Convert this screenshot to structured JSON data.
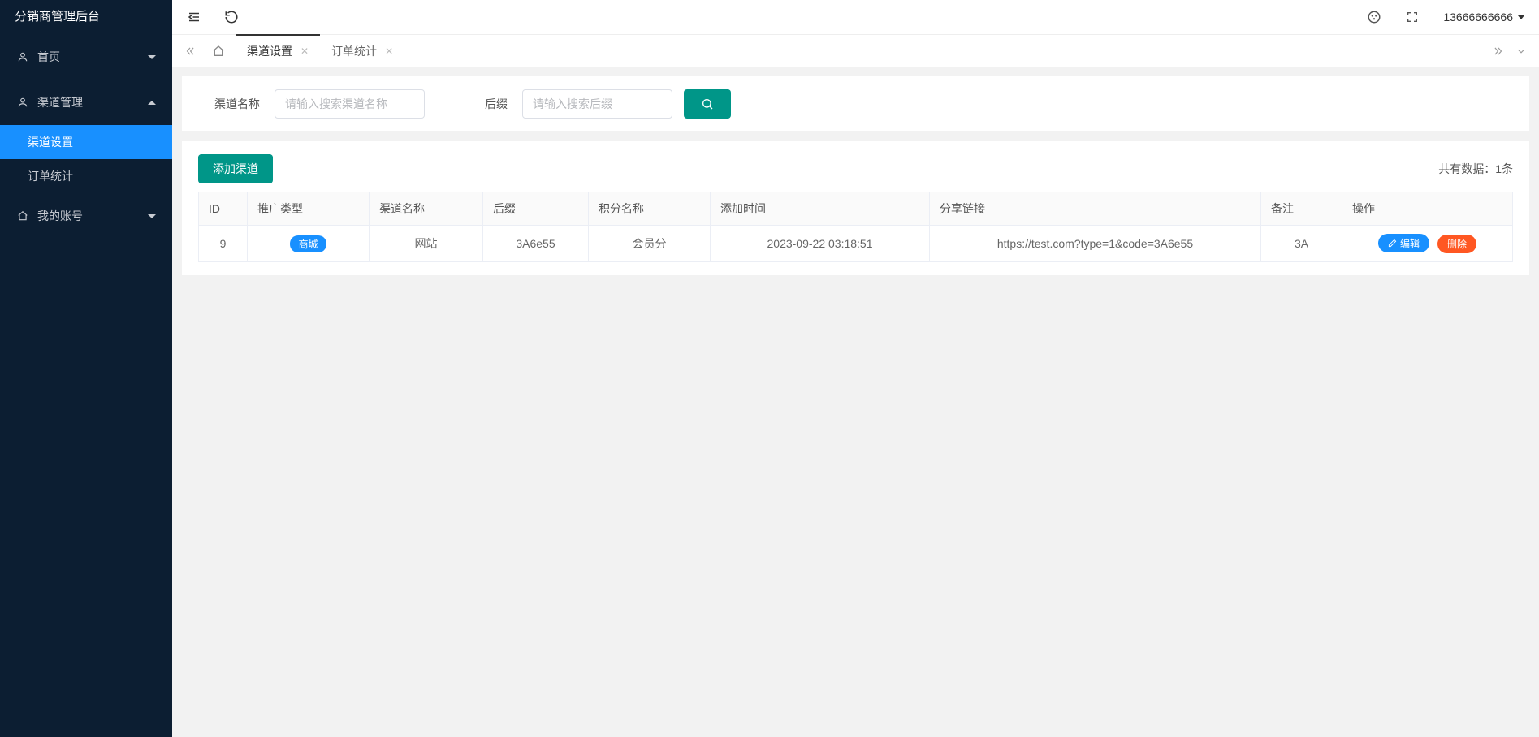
{
  "app_title": "分销商管理后台",
  "sidebar": {
    "items": [
      {
        "label": "首页",
        "icon": "user-icon",
        "type": "submenu",
        "expanded": false
      },
      {
        "label": "渠道管理",
        "icon": "user-icon",
        "type": "submenu",
        "expanded": true,
        "children": [
          {
            "label": "渠道设置",
            "active": true
          },
          {
            "label": "订单统计",
            "active": false
          }
        ]
      },
      {
        "label": "我的账号",
        "icon": "home-icon",
        "type": "submenu",
        "expanded": false
      }
    ]
  },
  "topbar": {
    "user_label": "13666666666"
  },
  "tabs": {
    "items": [
      {
        "label": "渠道设置",
        "active": true
      },
      {
        "label": "订单统计",
        "active": false
      }
    ]
  },
  "search": {
    "name_label": "渠道名称",
    "name_placeholder": "请输入搜索渠道名称",
    "suffix_label": "后缀",
    "suffix_placeholder": "请输入搜索后缀"
  },
  "toolbar": {
    "add_label": "添加渠道",
    "count_prefix": "共有数据：",
    "count_value": "1条"
  },
  "table": {
    "headers": [
      "ID",
      "推广类型",
      "渠道名称",
      "后缀",
      "积分名称",
      "添加时间",
      "分享链接",
      "备注",
      "操作"
    ],
    "rows": [
      {
        "id": "9",
        "type_tag": "商城",
        "name": "网站",
        "suffix": "3A6e55",
        "point_name": "会员分",
        "add_time": "2023-09-22 03:18:51",
        "share_link": "https://test.com?type=1&code=3A6e55",
        "remark": "3A",
        "edit_label": "编辑",
        "delete_label": "删除"
      }
    ]
  }
}
